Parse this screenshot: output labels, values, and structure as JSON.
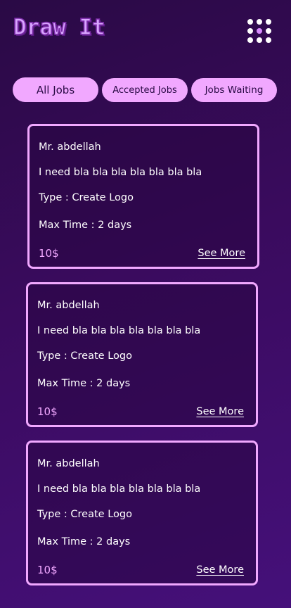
{
  "app": {
    "logo_text": "Draw It"
  },
  "header": {
    "menu_icon": "grid-menu-icon",
    "menu_accent_color": "#d98cff"
  },
  "tabs": [
    {
      "label": "All Jobs"
    },
    {
      "label": "Accepted Jobs"
    },
    {
      "label": "Jobs Waiting"
    }
  ],
  "jobs": [
    {
      "client": "Mr. abdellah",
      "description": "I need bla bla bla bla bla bla bla",
      "type": "Type : Create Logo",
      "max_time": "Max Time : 2 days",
      "price": "10$",
      "more_label": "See More"
    },
    {
      "client": "Mr. abdellah",
      "description": "I need bla bla bla bla bla bla bla",
      "type": "Type : Create Logo",
      "max_time": "Max Time : 2 days",
      "price": "10$",
      "more_label": "See More"
    },
    {
      "client": "Mr. abdellah",
      "description": "I need bla bla bla bla bla bla bla",
      "type": "Type : Create Logo",
      "max_time": "Max Time : 2 days",
      "price": "10$",
      "more_label": "See More"
    }
  ],
  "colors": {
    "accent": "#f1a8ff",
    "background": "#3a0b5e"
  }
}
